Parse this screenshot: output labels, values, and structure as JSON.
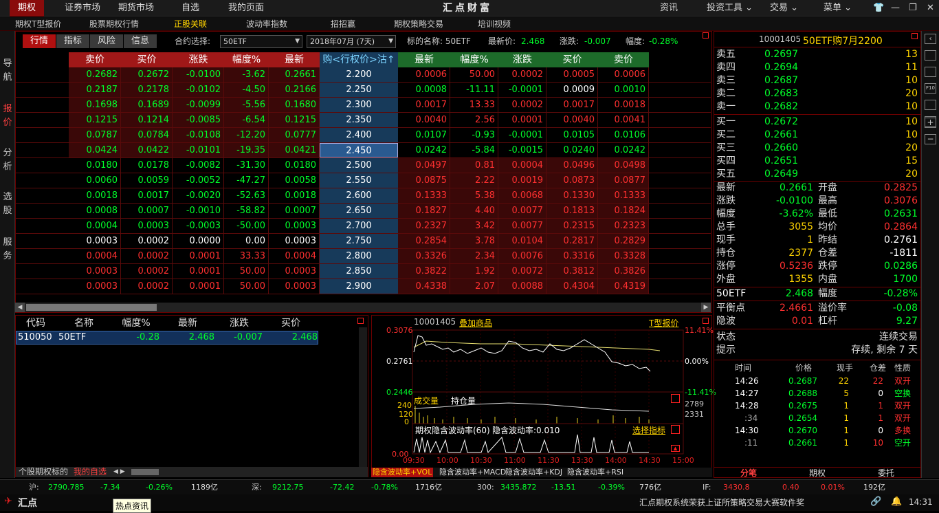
{
  "topnav": {
    "items": [
      "期权",
      "证券市场",
      "期货市场",
      "自选",
      "我的页面"
    ],
    "brand": "汇点财富",
    "right": [
      "资讯",
      "投资工具",
      "交易",
      "菜单"
    ]
  },
  "subnav": {
    "items": [
      "期权T型报价",
      "股票期权行情",
      "正股关联",
      "波动率指数",
      "招招赢",
      "期权策略交易",
      "培训视频"
    ],
    "active_index": 2
  },
  "leftnav": [
    "导航",
    "报价",
    "分析",
    "选股",
    "服务"
  ],
  "toolbar": {
    "tabs": [
      "行情",
      "指标",
      "风险",
      "信息"
    ],
    "contract_label": "合约选择:",
    "contract_value": "50ETF",
    "month_value": "2018年07月 (7天)",
    "underlying_label": "标的名称: 50ETF",
    "last_label": "最新价:",
    "last_value": "2.468",
    "change_label": "涨跌:",
    "change_value": "-0.007",
    "pct_label": "幅度:",
    "pct_value": "-0.28%"
  },
  "tquote": {
    "call_headers": [
      "卖价",
      "买价",
      "涨跌",
      "幅度%",
      "最新"
    ],
    "strike_header": "购<行权价>沽↑",
    "put_headers": [
      "最新",
      "幅度%",
      "涨跌",
      "买价",
      "卖价"
    ],
    "rows": [
      {
        "c": [
          "0.2682",
          "0.2672",
          "-0.0100",
          "-3.62",
          "0.2661"
        ],
        "s": "2.200",
        "p": [
          "0.0006",
          "50.00",
          "0.0002",
          "0.0005",
          "0.0006"
        ]
      },
      {
        "c": [
          "0.2187",
          "0.2178",
          "-0.0102",
          "-4.50",
          "0.2166"
        ],
        "s": "2.250",
        "p": [
          "0.0008",
          "-11.11",
          "-0.0001",
          "0.0009",
          "0.0010"
        ]
      },
      {
        "c": [
          "0.1698",
          "0.1689",
          "-0.0099",
          "-5.56",
          "0.1680"
        ],
        "s": "2.300",
        "p": [
          "0.0017",
          "13.33",
          "0.0002",
          "0.0017",
          "0.0018"
        ]
      },
      {
        "c": [
          "0.1215",
          "0.1214",
          "-0.0085",
          "-6.54",
          "0.1215"
        ],
        "s": "2.350",
        "p": [
          "0.0040",
          "2.56",
          "0.0001",
          "0.0040",
          "0.0041"
        ]
      },
      {
        "c": [
          "0.0787",
          "0.0784",
          "-0.0108",
          "-12.20",
          "0.0777"
        ],
        "s": "2.400",
        "p": [
          "0.0107",
          "-0.93",
          "-0.0001",
          "0.0105",
          "0.0106"
        ]
      },
      {
        "c": [
          "0.0424",
          "0.0422",
          "-0.0101",
          "-19.35",
          "0.0421"
        ],
        "s": "2.450",
        "p": [
          "0.0242",
          "-5.84",
          "-0.0015",
          "0.0240",
          "0.0242"
        ]
      },
      {
        "c": [
          "0.0180",
          "0.0178",
          "-0.0082",
          "-31.30",
          "0.0180"
        ],
        "s": "2.500",
        "p": [
          "0.0497",
          "0.81",
          "0.0004",
          "0.0496",
          "0.0498"
        ]
      },
      {
        "c": [
          "0.0060",
          "0.0059",
          "-0.0052",
          "-47.27",
          "0.0058"
        ],
        "s": "2.550",
        "p": [
          "0.0875",
          "2.22",
          "0.0019",
          "0.0873",
          "0.0877"
        ]
      },
      {
        "c": [
          "0.0018",
          "0.0017",
          "-0.0020",
          "-52.63",
          "0.0018"
        ],
        "s": "2.600",
        "p": [
          "0.1333",
          "5.38",
          "0.0068",
          "0.1330",
          "0.1333"
        ]
      },
      {
        "c": [
          "0.0008",
          "0.0007",
          "-0.0010",
          "-58.82",
          "0.0007"
        ],
        "s": "2.650",
        "p": [
          "0.1827",
          "4.40",
          "0.0077",
          "0.1813",
          "0.1824"
        ]
      },
      {
        "c": [
          "0.0004",
          "0.0003",
          "-0.0003",
          "-50.00",
          "0.0003"
        ],
        "s": "2.700",
        "p": [
          "0.2327",
          "3.42",
          "0.0077",
          "0.2315",
          "0.2323"
        ]
      },
      {
        "c": [
          "0.0003",
          "0.0002",
          "0.0000",
          "0.00",
          "0.0003"
        ],
        "s": "2.750",
        "p": [
          "0.2854",
          "3.78",
          "0.0104",
          "0.2817",
          "0.2829"
        ]
      },
      {
        "c": [
          "0.0004",
          "0.0002",
          "0.0001",
          "33.33",
          "0.0004"
        ],
        "s": "2.800",
        "p": [
          "0.3326",
          "2.34",
          "0.0076",
          "0.3316",
          "0.3328"
        ]
      },
      {
        "c": [
          "0.0003",
          "0.0002",
          "0.0001",
          "50.00",
          "0.0003"
        ],
        "s": "2.850",
        "p": [
          "0.3822",
          "1.92",
          "0.0072",
          "0.3812",
          "0.3826"
        ]
      },
      {
        "c": [
          "0.0003",
          "0.0002",
          "0.0001",
          "50.00",
          "0.0003"
        ],
        "s": "2.900",
        "p": [
          "0.4338",
          "2.07",
          "0.0088",
          "0.4304",
          "0.4319"
        ]
      }
    ],
    "selected_strike": "2.450"
  },
  "watchlist": {
    "headers": [
      "代码",
      "名称",
      "幅度%",
      "最新",
      "涨跌",
      "买价"
    ],
    "rows": [
      [
        "510050",
        "50ETF",
        "-0.28",
        "2.468",
        "-0.007",
        "2.468"
      ]
    ],
    "tabs": [
      "个股期权标的",
      "我的自选"
    ]
  },
  "chart": {
    "code": "10001405",
    "add_label": "叠加商品",
    "t_label": "T型报价",
    "y_left": [
      "0.3076",
      "0.2761",
      "0.2446"
    ],
    "y_right": [
      "11.41%",
      "0.00%",
      "-11.41%"
    ],
    "vol_title": "成交量",
    "oi_title": "持仓量",
    "vol_left": [
      "240",
      "120",
      "0"
    ],
    "vol_right": [
      "2789",
      "2331"
    ],
    "iv_title": "期权隐含波动率(60)",
    "iv_value_label": "隐含波动率:0.010",
    "iv_link": "选择指标",
    "iv_left": "0.00",
    "x_ticks": [
      "09:30",
      "10:00",
      "10:30",
      "11:00",
      "11:30",
      "13:30",
      "14:00",
      "14:30",
      "15:00"
    ],
    "bottom_tabs": [
      "隐含波动率+VOL",
      "隐含波动率+MACD",
      "隐含波动率+KDJ",
      "隐含波动率+RSI"
    ]
  },
  "right": {
    "code": "10001405",
    "name": "50ETF购7月2200",
    "asks": [
      [
        "卖五",
        "0.2697",
        "13"
      ],
      [
        "卖四",
        "0.2694",
        "11"
      ],
      [
        "卖三",
        "0.2687",
        "10"
      ],
      [
        "卖二",
        "0.2683",
        "20"
      ],
      [
        "卖一",
        "0.2682",
        "10"
      ]
    ],
    "bids": [
      [
        "买一",
        "0.2672",
        "10"
      ],
      [
        "买二",
        "0.2661",
        "10"
      ],
      [
        "买三",
        "0.2660",
        "20"
      ],
      [
        "买四",
        "0.2651",
        "15"
      ],
      [
        "买五",
        "0.2649",
        "20"
      ]
    ],
    "stats": [
      [
        "最新",
        "0.2661",
        "开盘",
        "0.2825"
      ],
      [
        "涨跌",
        "-0.0100",
        "最高",
        "0.3076"
      ],
      [
        "幅度",
        "-3.62%",
        "最低",
        "0.2631"
      ],
      [
        "总手",
        "3055",
        "均价",
        "0.2864"
      ],
      [
        "现手",
        "1",
        "昨结",
        "0.2761"
      ],
      [
        "持仓",
        "2377",
        "仓差",
        "-1811"
      ],
      [
        "涨停",
        "0.5236",
        "跌停",
        "0.0286"
      ],
      [
        "外盘",
        "1355",
        "内盘",
        "1700"
      ]
    ],
    "underlying": [
      "50ETF",
      "2.468",
      "幅度",
      "-0.28%"
    ],
    "extra": [
      [
        "平衡点",
        "2.4661",
        "溢价率",
        "-0.08"
      ],
      [
        "隐波",
        "0.01",
        "杠杆",
        "9.27"
      ]
    ],
    "status": [
      [
        "状态",
        "连续交易"
      ],
      [
        "提示",
        "存续, 剩余 7 天"
      ]
    ],
    "trade_headers": [
      "时间",
      "价格",
      "现手",
      "仓差",
      "性质"
    ],
    "trades": [
      [
        "14:26",
        "0.2687",
        "22",
        "22",
        "双开"
      ],
      [
        "14:27",
        "0.2688",
        "5",
        "0",
        "空换"
      ],
      [
        "14:28",
        "0.2675",
        "1",
        "1",
        "双开"
      ],
      [
        ":34",
        "0.2654",
        "1",
        "1",
        "双开"
      ],
      [
        "14:30",
        "0.2670",
        "1",
        "0",
        "多换"
      ],
      [
        ":11",
        "0.2661",
        "1",
        "10",
        "空开"
      ]
    ],
    "bottom_tabs": [
      "分笔",
      "期权",
      "委托"
    ]
  },
  "statusbar": {
    "sh": [
      "沪:",
      "2790.785",
      "-7.34",
      "-0.26%",
      "1189亿"
    ],
    "sz": [
      "深:",
      "9212.75",
      "-72.42",
      "-0.78%",
      "1716亿"
    ],
    "s300": [
      "300:",
      "3435.872",
      "-13.51",
      "-0.39%",
      "776亿"
    ],
    "if": [
      "IF:",
      "3430.8",
      "0.40",
      "0.01%",
      "192亿"
    ]
  },
  "bottombar": {
    "logo": "汇点",
    "tooltip": "热点资讯",
    "news": "汇点期权系统荣获上证所策略交易大赛软件奖",
    "time": "14:31"
  },
  "colors": {
    "up": "#ff3030",
    "down": "#00ff2a",
    "accent": "#ffd400",
    "brand_red": "#8a0b0b"
  }
}
